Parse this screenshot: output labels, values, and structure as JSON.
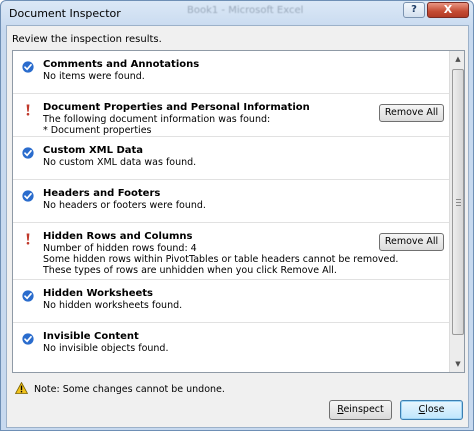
{
  "window": {
    "title": "Document Inspector",
    "background_title": "Book1 - Microsoft Excel",
    "help_label": "?",
    "close_label": "X"
  },
  "instruction": "Review the inspection results.",
  "items": [
    {
      "status": "ok",
      "status_icon": "check-circle-icon",
      "title": "Comments and Annotations",
      "lines": [
        "No items were found."
      ],
      "button": ""
    },
    {
      "status": "issue",
      "status_icon": "exclamation-icon",
      "title": "Document Properties and Personal Information",
      "lines": [
        "The following document information was found:",
        "* Document properties"
      ],
      "button": "Remove All"
    },
    {
      "status": "ok",
      "status_icon": "check-circle-icon",
      "title": "Custom XML Data",
      "lines": [
        "No custom XML data was found."
      ],
      "button": ""
    },
    {
      "status": "ok",
      "status_icon": "check-circle-icon",
      "title": "Headers and Footers",
      "lines": [
        "No headers or footers were found."
      ],
      "button": ""
    },
    {
      "status": "issue",
      "status_icon": "exclamation-icon",
      "title": "Hidden Rows and Columns",
      "lines": [
        "Number of hidden rows found: 4",
        "Some hidden rows within PivotTables or table headers cannot be removed.",
        "These types of rows are unhidden when you click Remove All."
      ],
      "button": "Remove All"
    },
    {
      "status": "ok",
      "status_icon": "check-circle-icon",
      "title": "Hidden Worksheets",
      "lines": [
        "No hidden worksheets found."
      ],
      "button": ""
    },
    {
      "status": "ok",
      "status_icon": "check-circle-icon",
      "title": "Invisible Content",
      "lines": [
        "No invisible objects found."
      ],
      "button": ""
    }
  ],
  "footer": {
    "note": "Note: Some changes cannot be undone.",
    "note_icon": "warning-icon",
    "reinspect_label": "Reinspect",
    "close_label": "Close"
  },
  "colors": {
    "check_blue": "#2a6ccd",
    "issue_red": "#c0392b",
    "warning_yellow": "#f2c31b"
  }
}
